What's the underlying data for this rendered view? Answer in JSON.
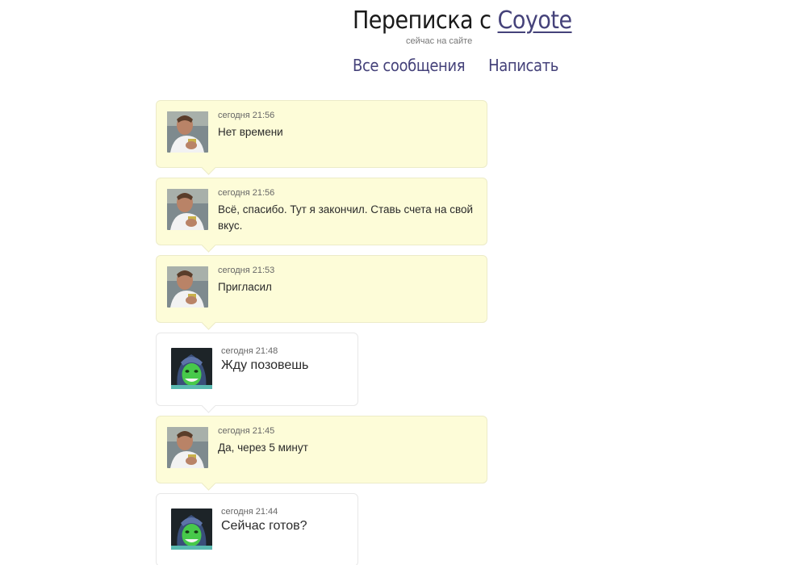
{
  "header": {
    "title_prefix": "Переписка с",
    "user_name": "Coyote",
    "status": "сейчас на сайте"
  },
  "nav": {
    "all_messages": "Все сообщения",
    "write": "Написать"
  },
  "messages": [
    {
      "author": "me",
      "time": "сегодня 21:56",
      "text": "Нет времени"
    },
    {
      "author": "me",
      "time": "сегодня 21:56",
      "text": "Всё, спасибо. Тут я закончил. Ставь счета на свой вкус."
    },
    {
      "author": "me",
      "time": "сегодня 21:53",
      "text": "Пригласил"
    },
    {
      "author": "other",
      "time": "сегодня 21:48",
      "text": "Жду позовешь"
    },
    {
      "author": "me",
      "time": "сегодня 21:45",
      "text": "Да, через 5 минут"
    },
    {
      "author": "other",
      "time": "сегодня 21:44",
      "text": "Сейчас готов?"
    }
  ]
}
